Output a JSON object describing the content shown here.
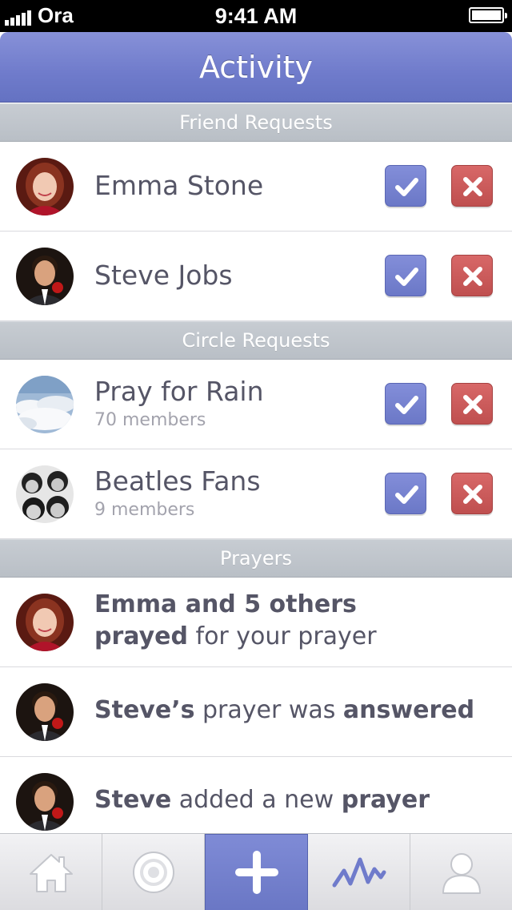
{
  "status_bar": {
    "carrier": "Ora",
    "time": "9:41 AM"
  },
  "nav": {
    "title": "Activity"
  },
  "sections": {
    "friend_requests": "Friend Requests",
    "circle_requests": "Circle Requests",
    "prayers": "Prayers"
  },
  "friend_requests": [
    {
      "name": "Emma Stone",
      "avatar": "emma-avatar"
    },
    {
      "name": "Steve Jobs",
      "avatar": "steve-avatar"
    }
  ],
  "circle_requests": [
    {
      "name": "Pray for Rain",
      "members": "70 members",
      "avatar": "clouds-avatar"
    },
    {
      "name": "Beatles Fans",
      "members": "9 members",
      "avatar": "beatles-avatar"
    }
  ],
  "prayers": [
    {
      "line1_bold": "Emma and 5 others",
      "line2_bold": "prayed",
      "line2_rest": " for your prayer"
    },
    {
      "bold1": "Steve’s",
      "rest": " prayer was ",
      "bold2": "answered"
    },
    {
      "bold1": "Steve",
      "rest": " added a new ",
      "bold2": "prayer"
    }
  ],
  "tabs": [
    "home-icon",
    "target-icon",
    "plus-icon",
    "activity-icon",
    "profile-icon"
  ],
  "colors": {
    "accent": "#737fcc",
    "accept": "#7480cf",
    "decline": "#cc5a5a",
    "section": "#bfc4ca"
  }
}
